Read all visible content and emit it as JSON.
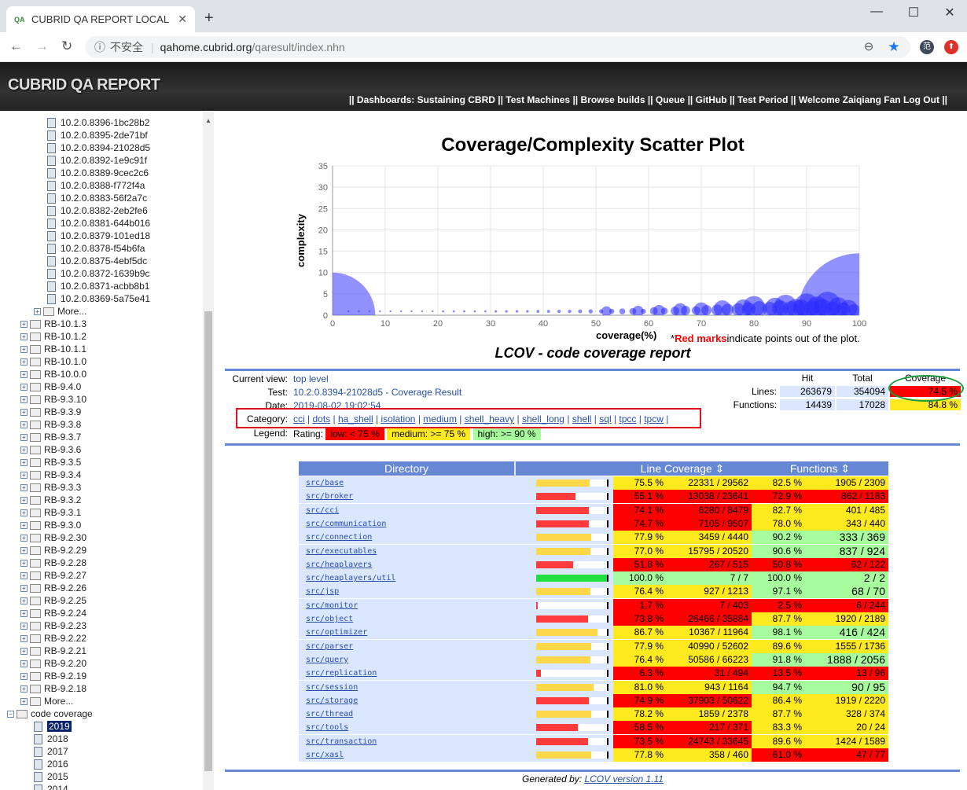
{
  "browser": {
    "tab_title": "CUBRID QA REPORT LOCAL",
    "tab_favicon": "QA",
    "security": "不安全",
    "url_host": "qahome.cubrid.org",
    "url_path": "/qaresult/index.nhn"
  },
  "header": {
    "brand": "CUBRID QA REPORT",
    "nav": "|| Dashboards: Sustaining CBRD || Test Machines || Browse builds || Queue || GitHub || Test Period || Welcome Zaiqiang Fan Log Out ||"
  },
  "sidebar": {
    "builds": [
      "10.2.0.8396-1bc28b2",
      "10.2.0.8395-2de71bf",
      "10.2.0.8394-21028d5",
      "10.2.0.8392-1e9c91f",
      "10.2.0.8389-9cec2c6",
      "10.2.0.8388-f772f4a",
      "10.2.0.8383-56f2a7c",
      "10.2.0.8382-2eb2fe6",
      "10.2.0.8381-644b016",
      "10.2.0.8379-101ed18",
      "10.2.0.8378-f54b6fa",
      "10.2.0.8375-4ebf5dc",
      "10.2.0.8372-1639b9c",
      "10.2.0.8371-acbb8b1",
      "10.2.0.8369-5a75e41"
    ],
    "more1": "More...",
    "branches": [
      "RB-10.1.3",
      "RB-10.1.2",
      "RB-10.1.1",
      "RB-10.1.0",
      "RB-10.0.0",
      "RB-9.4.0",
      "RB-9.3.10",
      "RB-9.3.9",
      "RB-9.3.8",
      "RB-9.3.7",
      "RB-9.3.6",
      "RB-9.3.5",
      "RB-9.3.4",
      "RB-9.3.3",
      "RB-9.3.2",
      "RB-9.3.1",
      "RB-9.3.0",
      "RB-9.2.30",
      "RB-9.2.29",
      "RB-9.2.28",
      "RB-9.2.27",
      "RB-9.2.26",
      "RB-9.2.25",
      "RB-9.2.24",
      "RB-9.2.23",
      "RB-9.2.22",
      "RB-9.2.21",
      "RB-9.2.20",
      "RB-9.2.19",
      "RB-9.2.18"
    ],
    "more2": "More...",
    "coverage_label": "code coverage",
    "years": [
      "2019",
      "2018",
      "2017",
      "2016",
      "2015",
      "2014"
    ]
  },
  "plot": {
    "title": "Coverage/Complexity Scatter Plot",
    "xlabel": "coverage(%)",
    "ylabel": "complexity",
    "note_prefix": "*",
    "note_red": "Red marks",
    "note_rest": "indicate points out of the plot."
  },
  "chart_data": {
    "type": "scatter",
    "title": "Coverage/Complexity Scatter Plot",
    "xlabel": "coverage(%)",
    "ylabel": "complexity",
    "xlim": [
      0,
      100
    ],
    "ylim": [
      0,
      35
    ],
    "xticks": [
      0,
      10,
      20,
      30,
      40,
      50,
      60,
      70,
      80,
      90,
      100
    ],
    "yticks": [
      0,
      5,
      10,
      15,
      20,
      25,
      30,
      35
    ],
    "grid": true,
    "big_bubbles": [
      {
        "x": 0,
        "y": 0,
        "r": 10
      },
      {
        "x": 100,
        "y": 0,
        "r": 14.5
      }
    ],
    "points": [
      [
        3,
        0.9,
        0.2
      ],
      [
        5,
        0.9,
        0.2
      ],
      [
        7,
        0.9,
        0.2
      ],
      [
        9,
        0.9,
        0.2
      ],
      [
        11,
        0.9,
        0.2
      ],
      [
        13,
        0.9,
        0.2
      ],
      [
        15,
        0.9,
        0.2
      ],
      [
        17,
        0.9,
        0.2
      ],
      [
        19,
        0.9,
        0.2
      ],
      [
        21,
        0.9,
        0.25
      ],
      [
        23,
        0.9,
        0.25
      ],
      [
        25,
        0.9,
        0.25
      ],
      [
        27,
        0.9,
        0.25
      ],
      [
        29,
        0.9,
        0.25
      ],
      [
        31,
        0.9,
        0.3
      ],
      [
        33,
        0.9,
        0.3
      ],
      [
        35,
        0.9,
        0.3
      ],
      [
        37,
        0.9,
        0.3
      ],
      [
        39,
        0.9,
        0.35
      ],
      [
        41,
        0.9,
        0.35
      ],
      [
        43,
        0.9,
        0.4
      ],
      [
        45,
        0.9,
        0.4
      ],
      [
        47,
        0.9,
        0.45
      ],
      [
        49,
        0.9,
        0.5
      ],
      [
        51,
        0.9,
        0.5
      ],
      [
        53,
        0.9,
        0.6
      ],
      [
        55,
        0.9,
        0.7
      ],
      [
        57,
        0.9,
        0.8
      ],
      [
        59,
        0.9,
        0.6
      ],
      [
        61,
        1.0,
        0.9
      ],
      [
        63,
        1.0,
        0.8
      ],
      [
        65,
        1.0,
        1.0
      ],
      [
        67,
        1.1,
        1.1
      ],
      [
        69,
        1.1,
        1.0
      ],
      [
        71,
        1.2,
        1.2
      ],
      [
        73,
        1.2,
        1.3
      ],
      [
        75,
        1.3,
        1.4
      ],
      [
        77,
        1.3,
        1.5
      ],
      [
        79,
        1.4,
        1.6
      ],
      [
        81,
        1.5,
        1.8
      ],
      [
        83,
        1.4,
        1.7
      ],
      [
        85,
        1.6,
        1.9
      ],
      [
        87,
        1.5,
        1.8
      ],
      [
        89,
        1.7,
        2.0
      ],
      [
        91,
        1.6,
        1.8
      ],
      [
        93,
        1.8,
        2.0
      ],
      [
        95,
        1.5,
        1.7
      ],
      [
        97,
        1.4,
        1.6
      ],
      [
        99,
        1.2,
        1.4
      ],
      [
        52,
        0.9,
        1.2
      ],
      [
        58,
        0.9,
        1.3
      ],
      [
        62,
        1.0,
        1.4
      ],
      [
        66,
        1.2,
        1.6
      ],
      [
        70,
        1.3,
        1.7
      ],
      [
        74,
        1.5,
        2.0
      ],
      [
        78,
        1.6,
        2.1
      ],
      [
        80,
        2.0,
        2.5
      ],
      [
        84,
        1.8,
        2.3
      ],
      [
        86,
        2.2,
        2.6
      ],
      [
        88,
        1.6,
        2.2
      ],
      [
        90,
        2.3,
        2.8
      ],
      [
        92,
        2.0,
        2.4
      ],
      [
        94,
        2.5,
        3.0
      ],
      [
        96,
        1.9,
        2.3
      ],
      [
        98,
        1.6,
        2.0
      ]
    ]
  },
  "report": {
    "title": "LCOV - code coverage report",
    "current_view_label": "Current view:",
    "current_view": "top level",
    "test_label": "Test:",
    "test": "10.2.0.8394-21028d5 - Coverage Result",
    "date_label": "Date:",
    "date": "2019-08-02 19:02:54",
    "category_label": "Category:",
    "categories": [
      "cci",
      "dots",
      "ha_shell",
      "isolation",
      "medium",
      "shell_heavy",
      "shell_long",
      "shell",
      "sql",
      "tpcc",
      "tpcw"
    ],
    "legend_label": "Legend:",
    "rating_label": "Rating:",
    "rating_low": "low: < 75 %",
    "rating_medium": "medium: >= 75 %",
    "rating_high": "high: >= 90 %",
    "summary": {
      "hit_h": "Hit",
      "total_h": "Total",
      "coverage_h": "Coverage",
      "lines_label": "Lines:",
      "lines_hit": "263679",
      "lines_total": "354094",
      "lines_cov": "74.5 %",
      "func_label": "Functions:",
      "func_hit": "14439",
      "func_total": "17028",
      "func_cov": "84.8 %"
    },
    "table_headers": {
      "directory": "Directory",
      "line_coverage": "Line Coverage",
      "functions": "Functions",
      "sort": "⇕"
    },
    "rows": [
      {
        "dir": "src/base",
        "lp": "75.5 %",
        "lc": "22331 / 29562",
        "fp": "82.5 %",
        "fc": "1905 / 2309",
        "pct": 75.5,
        "lr": "m",
        "fr": "m"
      },
      {
        "dir": "src/broker",
        "lp": "55.1 %",
        "lc": "13038 / 23641",
        "fp": "72.9 %",
        "fc": "862 / 1183",
        "pct": 55.1,
        "lr": "l",
        "fr": "l"
      },
      {
        "dir": "src/cci",
        "lp": "74.1 %",
        "lc": "6280 / 8479",
        "fp": "82.7 %",
        "fc": "401 / 485",
        "pct": 74.1,
        "lr": "l",
        "fr": "m"
      },
      {
        "dir": "src/communication",
        "lp": "74.7 %",
        "lc": "7105 / 9507",
        "fp": "78.0 %",
        "fc": "343 / 440",
        "pct": 74.7,
        "lr": "l",
        "fr": "m"
      },
      {
        "dir": "src/connection",
        "lp": "77.9 %",
        "lc": "3459 / 4440",
        "fp": "90.2 %",
        "fc": "333 / 369",
        "pct": 77.9,
        "lr": "m",
        "fr": "h"
      },
      {
        "dir": "src/executables",
        "lp": "77.0 %",
        "lc": "15795 / 20520",
        "fp": "90.6 %",
        "fc": "837 / 924",
        "pct": 77.0,
        "lr": "m",
        "fr": "h"
      },
      {
        "dir": "src/heaplayers",
        "lp": "51.8 %",
        "lc": "267 / 515",
        "fp": "50.8 %",
        "fc": "62 / 122",
        "pct": 51.8,
        "lr": "l",
        "fr": "l"
      },
      {
        "dir": "src/heaplayers/util",
        "lp": "100.0 %",
        "lc": "7 / 7",
        "fp": "100.0 %",
        "fc": "2 / 2",
        "pct": 100,
        "lr": "h",
        "fr": "h"
      },
      {
        "dir": "src/jsp",
        "lp": "76.4 %",
        "lc": "927 / 1213",
        "fp": "97.1 %",
        "fc": "68 / 70",
        "pct": 76.4,
        "lr": "m",
        "fr": "h"
      },
      {
        "dir": "src/monitor",
        "lp": "1.7 %",
        "lc": "7 / 403",
        "fp": "2.5 %",
        "fc": "6 / 244",
        "pct": 1.7,
        "lr": "l",
        "fr": "l"
      },
      {
        "dir": "src/object",
        "lp": "73.8 %",
        "lc": "26466 / 35884",
        "fp": "87.7 %",
        "fc": "1920 / 2189",
        "pct": 73.8,
        "lr": "l",
        "fr": "m"
      },
      {
        "dir": "src/optimizer",
        "lp": "86.7 %",
        "lc": "10367 / 11964",
        "fp": "98.1 %",
        "fc": "416 / 424",
        "pct": 86.7,
        "lr": "m",
        "fr": "h"
      },
      {
        "dir": "src/parser",
        "lp": "77.9 %",
        "lc": "40990 / 52602",
        "fp": "89.6 %",
        "fc": "1555 / 1736",
        "pct": 77.9,
        "lr": "m",
        "fr": "m"
      },
      {
        "dir": "src/query",
        "lp": "76.4 %",
        "lc": "50586 / 66223",
        "fp": "91.8 %",
        "fc": "1888 / 2056",
        "pct": 76.4,
        "lr": "m",
        "fr": "h"
      },
      {
        "dir": "src/replication",
        "lp": "6.3 %",
        "lc": "31 / 494",
        "fp": "13.5 %",
        "fc": "13 / 96",
        "pct": 6.3,
        "lr": "l",
        "fr": "l"
      },
      {
        "dir": "src/session",
        "lp": "81.0 %",
        "lc": "943 / 1164",
        "fp": "94.7 %",
        "fc": "90 / 95",
        "pct": 81.0,
        "lr": "m",
        "fr": "h"
      },
      {
        "dir": "src/storage",
        "lp": "74.9 %",
        "lc": "37903 / 50622",
        "fp": "86.4 %",
        "fc": "1919 / 2220",
        "pct": 74.9,
        "lr": "l",
        "fr": "m"
      },
      {
        "dir": "src/thread",
        "lp": "78.2 %",
        "lc": "1859 / 2378",
        "fp": "87.7 %",
        "fc": "328 / 374",
        "pct": 78.2,
        "lr": "m",
        "fr": "m"
      },
      {
        "dir": "src/tools",
        "lp": "58.5 %",
        "lc": "217 / 371",
        "fp": "83.3 %",
        "fc": "20 / 24",
        "pct": 58.5,
        "lr": "l",
        "fr": "m"
      },
      {
        "dir": "src/transaction",
        "lp": "73.5 %",
        "lc": "24743 / 33645",
        "fp": "89.6 %",
        "fc": "1424 / 1589",
        "pct": 73.5,
        "lr": "l",
        "fr": "m"
      },
      {
        "dir": "src/xasl",
        "lp": "77.8 %",
        "lc": "358 / 460",
        "fp": "61.0 %",
        "fc": "47 / 77",
        "pct": 77.8,
        "lr": "m",
        "fr": "l"
      }
    ],
    "footer_prefix": "Generated by:",
    "footer_link": "LCOV version 1.11"
  },
  "colors": {
    "low": "#ff0000",
    "medium": "#ffea20",
    "high": "#a7fc9d",
    "bar_low": "#ff3b3b",
    "bar_medium": "#ffd84a",
    "bar_high": "#20e040",
    "header_blue": "#6688d4",
    "bubble": "#4a4aff"
  }
}
